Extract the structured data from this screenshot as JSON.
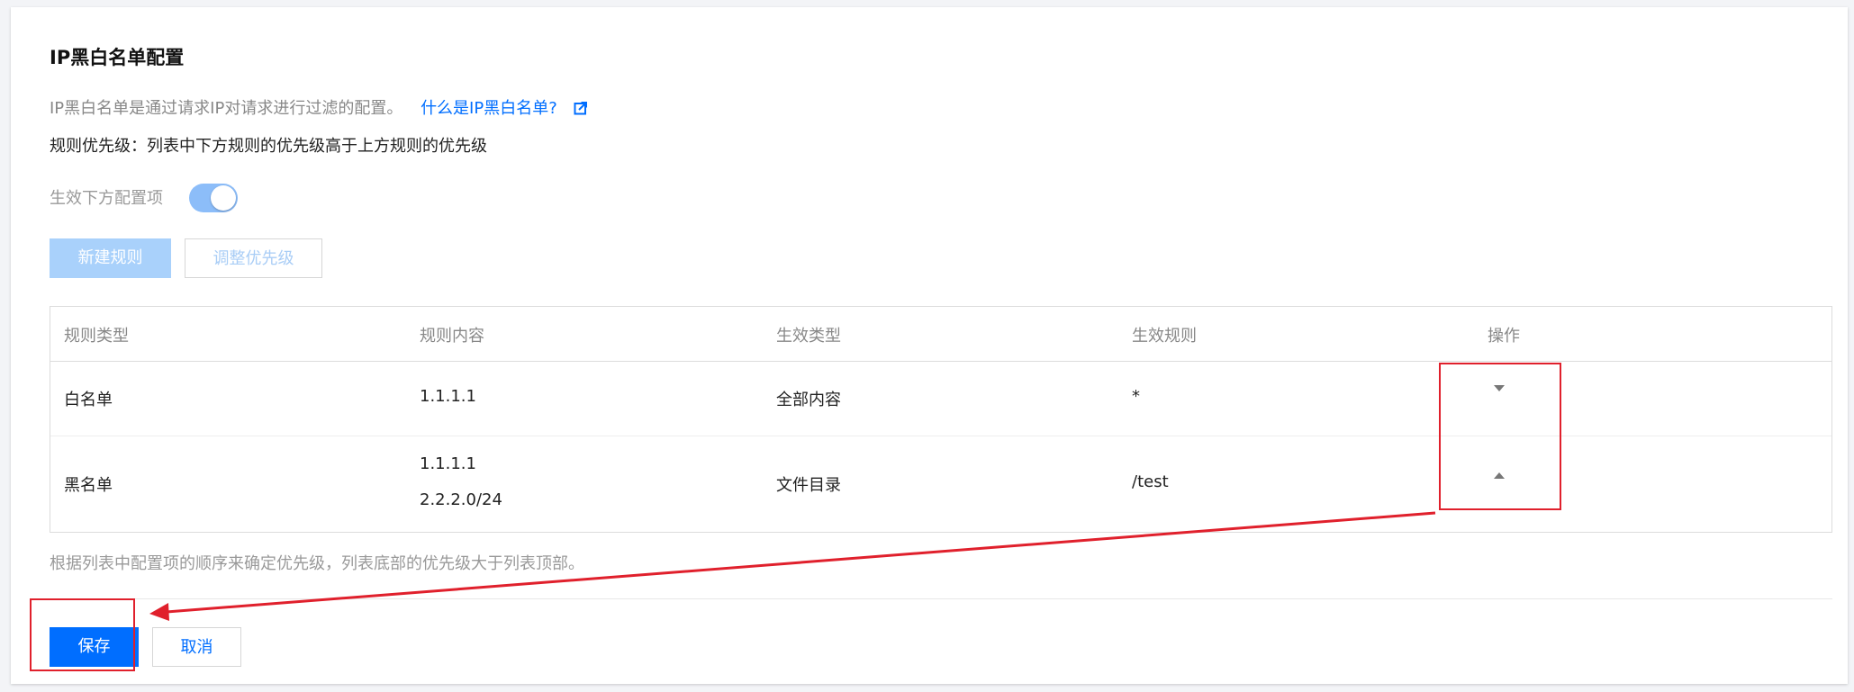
{
  "page": {
    "title": "IP黑白名单配置",
    "description": "IP黑白名单是通过请求IP对请求进行过滤的配置。",
    "help_link": "什么是IP黑白名单?",
    "priority_note": "规则优先级：列表中下方规则的优先级高于上方规则的优先级",
    "toggle_label": "生效下方配置项",
    "toggle_on": true
  },
  "toolbar": {
    "new_rule": "新建规则",
    "adjust_priority": "调整优先级"
  },
  "table": {
    "columns": [
      "规则类型",
      "规则内容",
      "生效类型",
      "生效规则",
      "操作"
    ],
    "rows": [
      {
        "type": "白名单",
        "content": [
          "1.1.1.1"
        ],
        "effect_type": "全部内容",
        "effect_rule": "*",
        "action_icon": "move-down-icon"
      },
      {
        "type": "黑名单",
        "content": [
          "1.1.1.1",
          "2.2.2.0/24"
        ],
        "effect_type": "文件目录",
        "effect_rule": "/test",
        "action_icon": "move-up-icon"
      }
    ]
  },
  "footnote": "根据列表中配置项的顺序来确定优先级，列表底部的优先级大于列表顶部。",
  "actions": {
    "save": "保存",
    "cancel": "取消"
  },
  "colors": {
    "primary": "#006eff",
    "annotation_red": "#e0202c"
  }
}
